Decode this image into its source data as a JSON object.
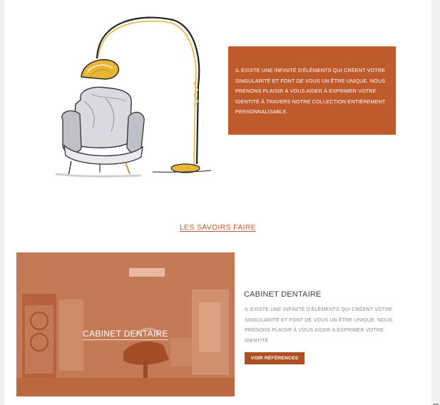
{
  "intro": {
    "text": "IL EXISTE UNE INFINITÉ D'ÉLÉMENTS QUI CRÉENT VOTRE SINGULARITÉ ET FONT DE VOUS UN ÊTRE UNIQUE. NOUS PRENONS PLAISIR À VOUS AIDER À EXPRIMER VOTRE IDENTITÉ À TRAVERS NOTRE COLLECTION ENTIÈREMENT PERSONNALISABLE."
  },
  "savoirs": {
    "title": "LES SAVOIRS FAIRE"
  },
  "card": {
    "image_label": "CABINET DENTAIRE",
    "title": "CABINET DENTAIRE",
    "text": "IL EXISTE UNE INFINITÉ D'ÉLÉMENTS QUI CRÉENT VOTRE SINGULARITÉ ET FONT DE VOUS UN ÊTRE UNIQUE. NOUS PRENONS PLAISIR À VOUS AIDER À EXPRIMER VOTRE IDENTITÉ",
    "button_label": "VOIR RÉFÉRENCES"
  },
  "icons": {
    "illustration": "armchair-and-arc-lamp-illustration",
    "photo": "dental-office-photo"
  },
  "colors": {
    "accent": "#bf5a2a",
    "button": "#b14f24",
    "overlay": "#c47652",
    "lamp_yellow": "#e8b537"
  }
}
